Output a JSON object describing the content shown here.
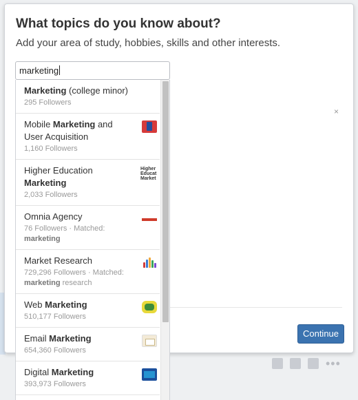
{
  "modal": {
    "title": "What topics do you know about?",
    "subtitle": "Add your area of study, hobbies, skills and other interests.",
    "close_glyph": "×",
    "continue_label": "Continue"
  },
  "search": {
    "value": "marketing"
  },
  "suggestions": [
    {
      "pre": "",
      "bold": "Marketing",
      "post": " (college minor)",
      "followers": "295 Followers",
      "matched": "",
      "matched_bold": "",
      "matched_post": "",
      "icon": "none"
    },
    {
      "pre": "Mobile ",
      "bold": "Marketing",
      "post": " and User Acquisition",
      "followers": "1,160 Followers",
      "matched": "",
      "matched_bold": "",
      "matched_post": "",
      "icon": "mobile-marketing-thumbnail"
    },
    {
      "pre": "Higher Education ",
      "bold": "Marketing",
      "post": "",
      "followers": "2,033 Followers",
      "matched": "",
      "matched_bold": "",
      "matched_post": "",
      "icon": "higher-education-thumbnail",
      "thumb_text": "Higher Educat Market"
    },
    {
      "pre": "Omnia Agency",
      "bold": "",
      "post": "",
      "followers": "76 Followers",
      "matched": " · Matched:",
      "matched_bold": "marketing",
      "matched_post": "",
      "icon": "omnia-agency-thumbnail"
    },
    {
      "pre": "Market Research",
      "bold": "",
      "post": "",
      "followers": "729,296 Followers",
      "matched": " · Matched:",
      "matched_bold": "marketing",
      "matched_post": " research",
      "icon": "market-research-thumbnail"
    },
    {
      "pre": "Web ",
      "bold": "Marketing",
      "post": "",
      "followers": "510,177 Followers",
      "matched": "",
      "matched_bold": "",
      "matched_post": "",
      "icon": "web-marketing-thumbnail"
    },
    {
      "pre": "Email ",
      "bold": "Marketing",
      "post": "",
      "followers": "654,360 Followers",
      "matched": "",
      "matched_bold": "",
      "matched_post": "",
      "icon": "email-marketing-thumbnail"
    },
    {
      "pre": "Digital ",
      "bold": "Marketing",
      "post": "",
      "followers": "393,973 Followers",
      "matched": "",
      "matched_bold": "",
      "matched_post": "",
      "icon": "digital-marketing-thumbnail"
    }
  ],
  "colors": {
    "accent": "#3b73b0",
    "muted_text": "#999999"
  }
}
